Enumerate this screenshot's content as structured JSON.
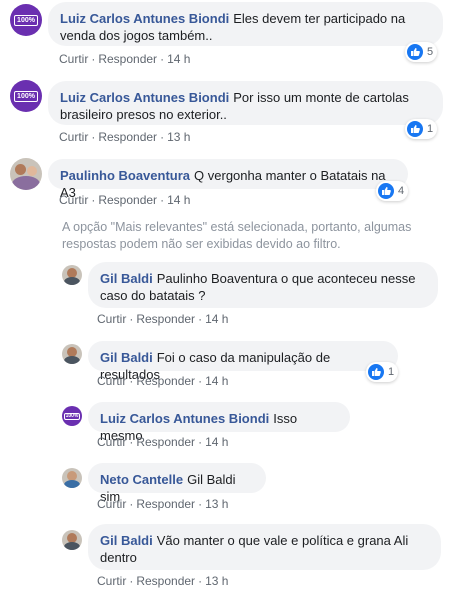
{
  "actions": {
    "reply": "Curtir",
    "respond": "Responder",
    "sep": "·"
  },
  "filter_notice": "A opção \"Mais relevantes\" está selecionada, portanto, algumas respostas podem não ser exibidas devido ao filtro.",
  "avatar_badge": "100%",
  "comments": [
    {
      "author": "Luiz Carlos Antunes Biondi",
      "text": "Eles devem ter participado na venda dos jogos também..",
      "time": "14 h",
      "likes": "5"
    },
    {
      "author": "Luiz Carlos Antunes Biondi",
      "text": "Por isso um monte de cartolas brasileiro presos no exterior..",
      "time": "13 h",
      "likes": "1"
    },
    {
      "author": "Paulinho Boaventura",
      "text": "Q vergonha manter o Batatais na A3",
      "time": "14 h",
      "likes": "4"
    }
  ],
  "replies": [
    {
      "author": "Gil Baldi",
      "text": "Paulinho Boaventura o que aconteceu nesse caso do batatais ?",
      "time": "14 h"
    },
    {
      "author": "Gil Baldi",
      "text": "Foi o caso da manipulação de resultados",
      "time": "14 h",
      "likes": "1"
    },
    {
      "author": "Luiz Carlos Antunes Biondi",
      "text": "Isso mesmo",
      "time": "14 h"
    },
    {
      "author": "Neto Cantelle",
      "text": "Gil Baldi sim",
      "time": "13 h"
    },
    {
      "author": "Gil Baldi",
      "text": "Vão manter o que vale e política e grana Ali dentro",
      "time": "13 h"
    }
  ],
  "colors": {
    "author": "#385898",
    "bubble": "#f2f3f5",
    "like": "#1877f2",
    "meta": "#606770",
    "notice": "#8d949e"
  }
}
